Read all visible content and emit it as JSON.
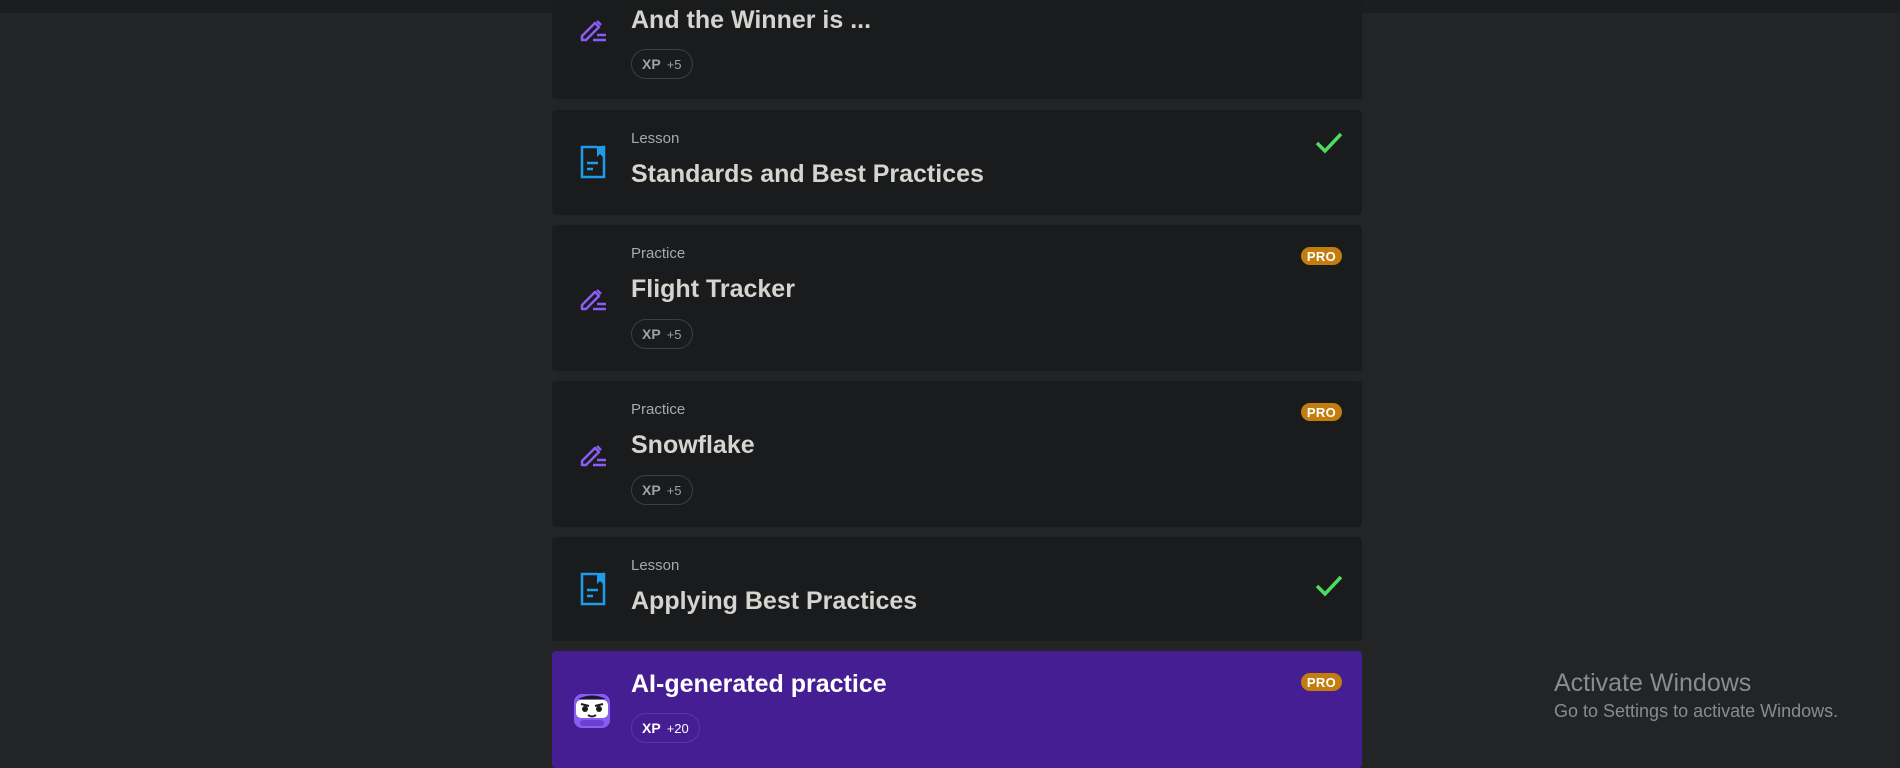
{
  "items": [
    {
      "type": "",
      "title": "And the Winner is ...",
      "xp_label": "XP",
      "xp_value": "+5",
      "icon": "pencil-icon"
    },
    {
      "type": "Lesson",
      "title": "Standards and Best Practices",
      "icon": "document-icon",
      "status": "completed"
    },
    {
      "type": "Practice",
      "title": "Flight Tracker",
      "xp_label": "XP",
      "xp_value": "+5",
      "badge": "PRO",
      "icon": "pencil-icon"
    },
    {
      "type": "Practice",
      "title": "Snowflake",
      "xp_label": "XP",
      "xp_value": "+5",
      "badge": "PRO",
      "icon": "pencil-icon"
    },
    {
      "type": "Lesson",
      "title": "Applying Best Practices",
      "icon": "document-icon",
      "status": "completed"
    },
    {
      "type": "",
      "title": "AI-generated practice",
      "xp_label": "XP",
      "xp_value": "+20",
      "badge": "PRO",
      "icon": "robot-mascot-icon"
    }
  ],
  "watermark": {
    "title": "Activate Windows",
    "subtitle": "Go to Settings to activate Windows."
  },
  "colors": {
    "practice_icon": "#8b5cf6",
    "lesson_icon": "#1e9be9",
    "check": "#4ade5a",
    "pro_badge": "#c27d0e",
    "ai_card": "#451e93"
  }
}
